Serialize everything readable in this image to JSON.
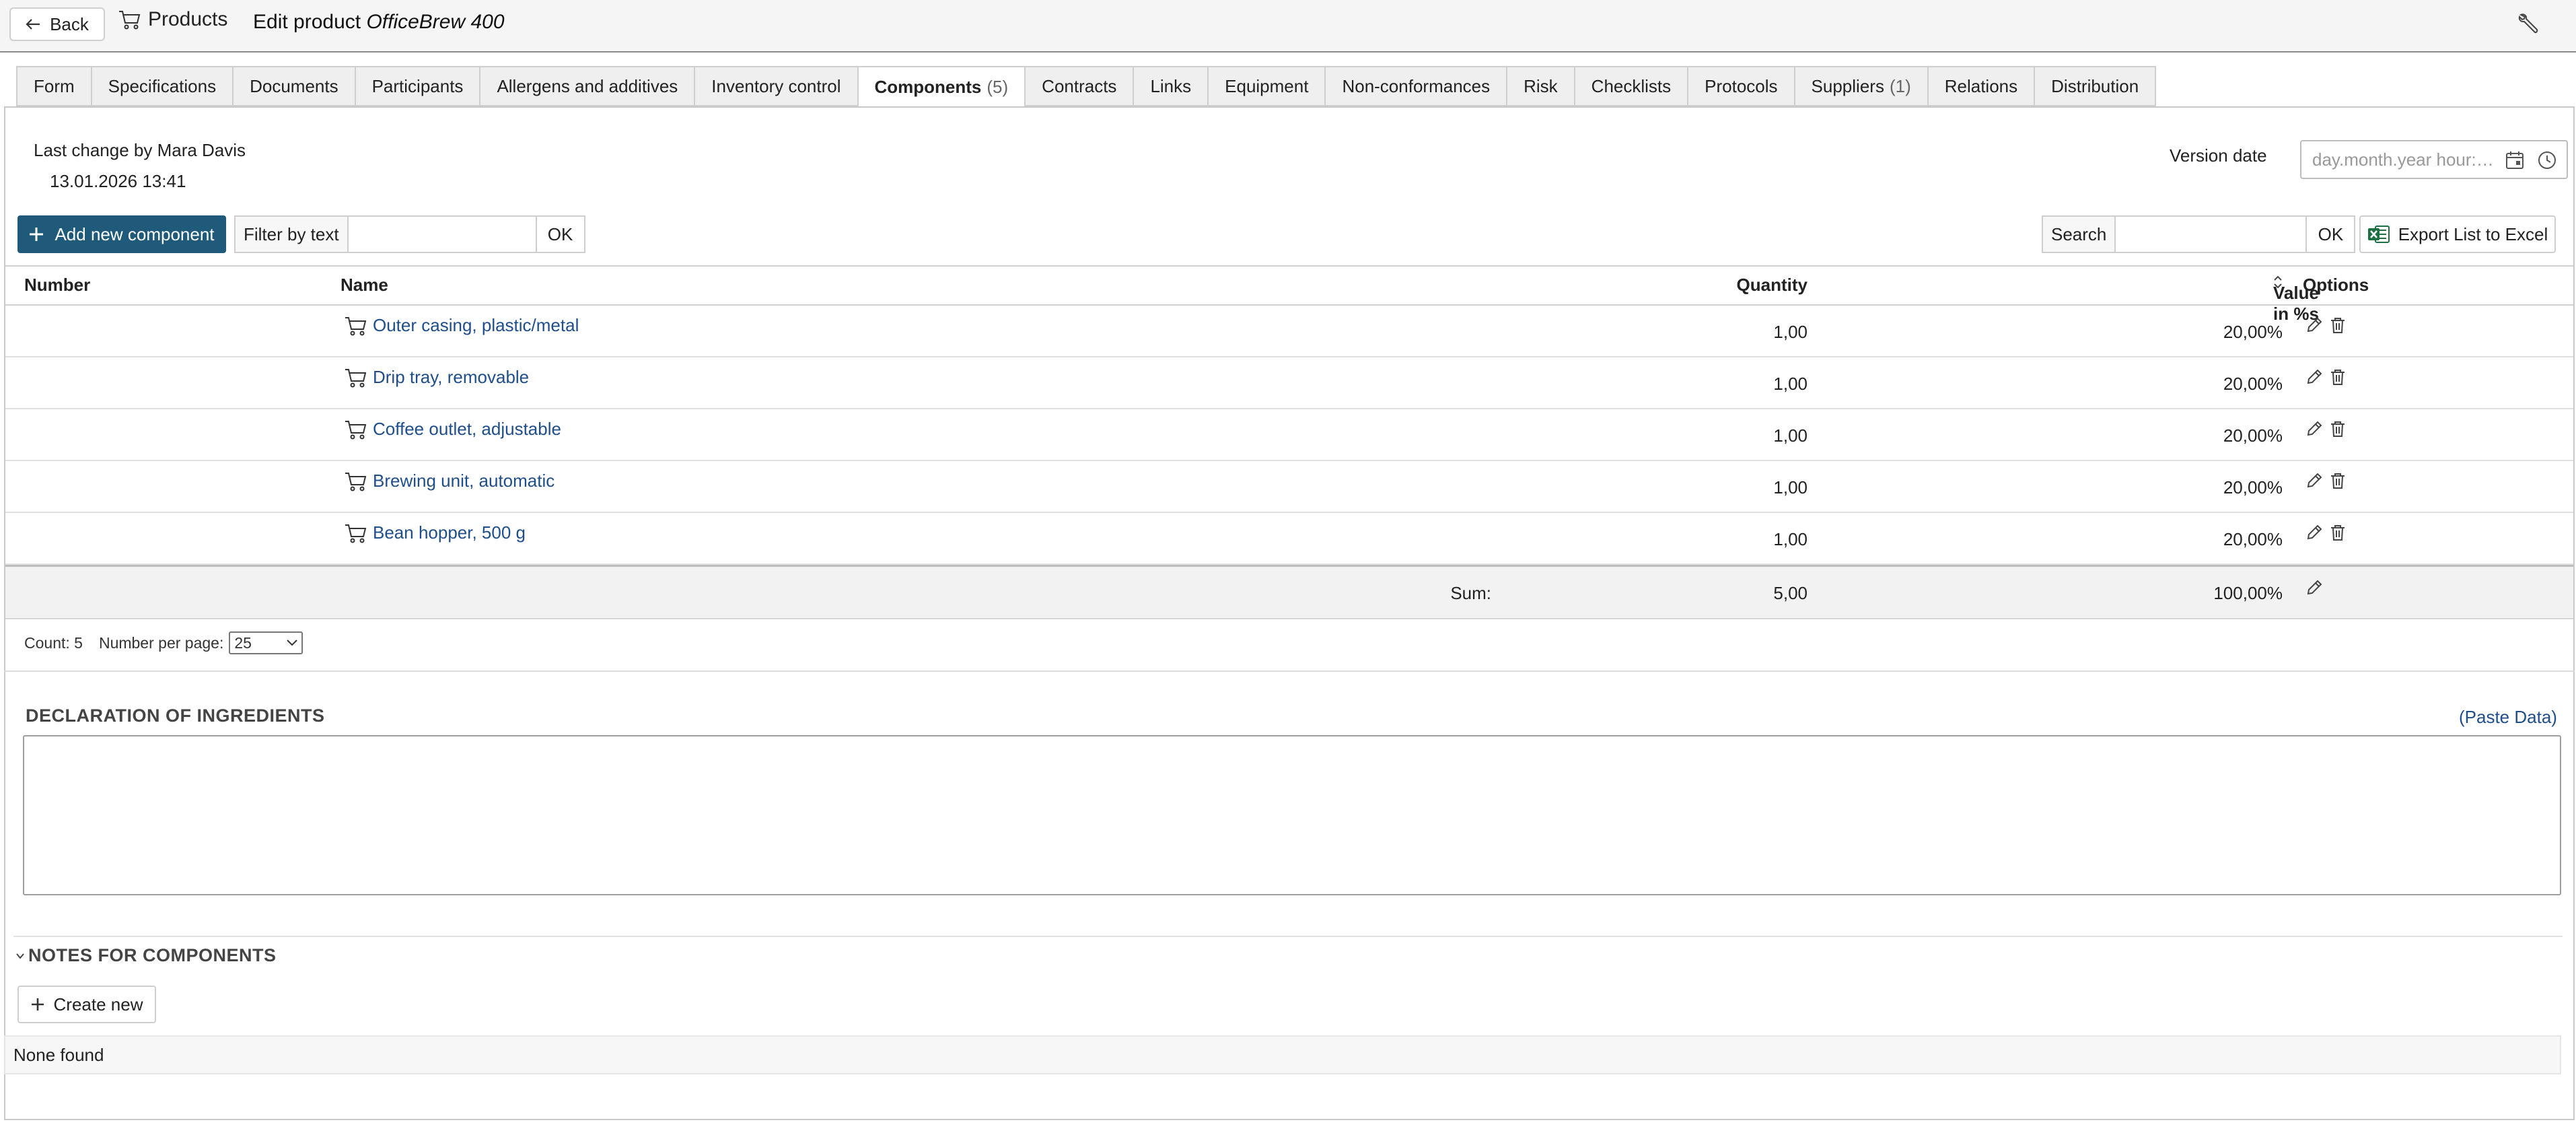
{
  "header": {
    "back_label": "Back",
    "products_label": "Products",
    "title_prefix": "Edit product ",
    "product_name": "OfficeBrew 400"
  },
  "tabs": [
    {
      "label": "Form",
      "count": ""
    },
    {
      "label": "Specifications",
      "count": ""
    },
    {
      "label": "Documents",
      "count": ""
    },
    {
      "label": "Participants",
      "count": ""
    },
    {
      "label": "Allergens and additives",
      "count": ""
    },
    {
      "label": "Inventory control",
      "count": ""
    },
    {
      "label": "Components",
      "count": "(5)",
      "active": true
    },
    {
      "label": "Contracts",
      "count": ""
    },
    {
      "label": "Links",
      "count": ""
    },
    {
      "label": "Equipment",
      "count": ""
    },
    {
      "label": "Non-conformances",
      "count": ""
    },
    {
      "label": "Risk",
      "count": ""
    },
    {
      "label": "Checklists",
      "count": ""
    },
    {
      "label": "Protocols",
      "count": ""
    },
    {
      "label": "Suppliers",
      "count": "(1)"
    },
    {
      "label": "Relations",
      "count": ""
    },
    {
      "label": "Distribution",
      "count": ""
    }
  ],
  "meta": {
    "last_change": "Last change by Mara Davis",
    "last_change_date": "13.01.2026 13:41",
    "version_label": "Version date",
    "version_placeholder": "day.month.year hour:minute"
  },
  "toolbar": {
    "add_label": "Add new component",
    "filter_label": "Filter by text",
    "filter_ok": "OK",
    "search_label": "Search",
    "search_ok": "OK",
    "export_label": "Export List to Excel"
  },
  "table": {
    "columns": {
      "number": "Number",
      "name": "Name",
      "quantity": "Quantity",
      "value": "Value in %s",
      "options": "Options"
    },
    "rows": [
      {
        "number": "",
        "name": "Outer casing, plastic/metal",
        "quantity": "1,00",
        "value": "20,00%"
      },
      {
        "number": "",
        "name": "Drip tray, removable",
        "quantity": "1,00",
        "value": "20,00%"
      },
      {
        "number": "",
        "name": "Coffee outlet, adjustable",
        "quantity": "1,00",
        "value": "20,00%"
      },
      {
        "number": "",
        "name": "Brewing unit, automatic",
        "quantity": "1,00",
        "value": "20,00%"
      },
      {
        "number": "",
        "name": "Bean hopper, 500 g",
        "quantity": "1,00",
        "value": "20,00%"
      }
    ],
    "sum": {
      "label": "Sum:",
      "quantity": "5,00",
      "value": "100,00%"
    }
  },
  "pager": {
    "count_label": "Count: 5",
    "per_page_label": "Number per page:",
    "per_page_value": "25"
  },
  "declaration": {
    "title": "DECLARATION OF INGREDIENTS",
    "paste_label": "(Paste Data)",
    "content": ""
  },
  "notes": {
    "title": "NOTES FOR COMPONENTS",
    "create_label": "Create new",
    "empty_text": "None found"
  },
  "colors": {
    "primary_button": "#1f5a7a",
    "link": "#1f4e8c",
    "excel_green": "#1d7044"
  },
  "icons": {
    "back": "arrow-left-icon",
    "products": "cart-icon",
    "settings": "wrench-icon",
    "calendar": "calendar-icon",
    "clock": "clock-icon",
    "add": "plus-icon",
    "export": "excel-icon",
    "row": "cart-icon",
    "edit": "pencil-icon",
    "delete": "trash-icon",
    "sort": "sort-icon",
    "collapse": "chevron-down-icon"
  }
}
